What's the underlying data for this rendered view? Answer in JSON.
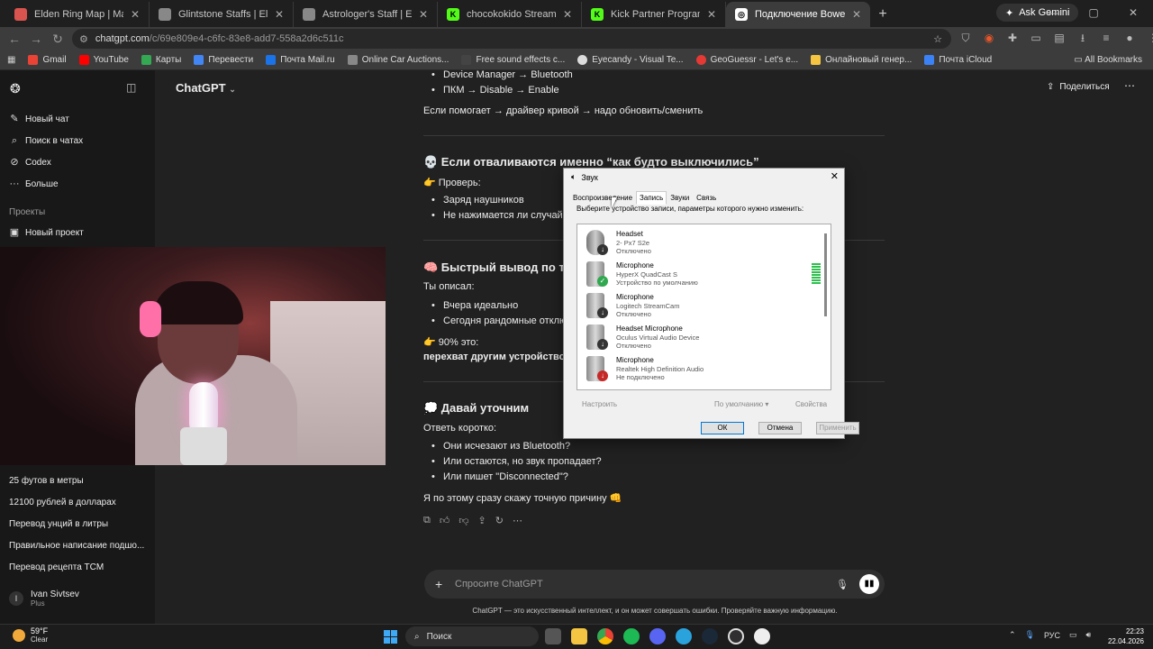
{
  "browser": {
    "tabs": [
      {
        "title": "Elden Ring Map | Map Genie",
        "color": "#d9534f"
      },
      {
        "title": "Glintstone Staffs | Elden Ring W",
        "color": "#888888"
      },
      {
        "title": "Astrologer's Staff | Elden Ring W",
        "color": "#888888"
      },
      {
        "title": "chocokokido Stream - Watch Li",
        "color": "#53fc18"
      },
      {
        "title": "Kick Partner Program - Kick De",
        "color": "#53fc18"
      },
      {
        "title": "Подключение Bowers & Wilkins",
        "color": "#ffffff"
      }
    ],
    "ask_gemini": "Ask Gemini",
    "url_host": "chatgpt.com",
    "url_path": "/c/69e809e4-c6fc-83e8-add7-558a2d6c511c",
    "bookmarks": [
      {
        "label": "Gmail",
        "color": "#ea4335"
      },
      {
        "label": "YouTube",
        "color": "#ff0000"
      },
      {
        "label": "Карты",
        "color": "#34a853"
      },
      {
        "label": "Перевести",
        "color": "#4285f4"
      },
      {
        "label": "Почта Mail.ru",
        "color": "#1a73e8"
      },
      {
        "label": "Online Car Auctions...",
        "color": "#888888"
      },
      {
        "label": "Free sound effects c...",
        "color": "#222222"
      },
      {
        "label": "Eyecandy - Visual Te...",
        "color": "#dddddd"
      },
      {
        "label": "GeoGuessr - Let's e...",
        "color": "#e53935"
      },
      {
        "label": "Онлайновый генер...",
        "color": "#f5c542"
      },
      {
        "label": "Почта iCloud",
        "color": "#3b82f6"
      }
    ],
    "all_bookmarks": "All Bookmarks"
  },
  "sidebar": {
    "new_chat": "Новый чат",
    "search_chats": "Поиск в чатах",
    "codex": "Codex",
    "more": "Больше",
    "projects_heading": "Проекты",
    "new_project": "Новый проект",
    "history": [
      "25 футов в метры",
      "12100 рублей в долларах",
      "Перевод унций в литры",
      "Правильное написание подшо...",
      "Перевод рецепта TCM"
    ],
    "user_name": "Ivan Sivtsev",
    "user_plan": "Plus",
    "user_initial": "I"
  },
  "header": {
    "title": "ChatGPT",
    "share": "Поделиться"
  },
  "chat": {
    "line1": "Device Manager → Bluetooth",
    "line2": "ПКМ → Disable → Enable",
    "line3": "Если помогает → драйвер кривой → надо обновить/сменить",
    "h1": "💀 Если отваливаются именно “как будто выключились”",
    "check": "👉 Проверь:",
    "b1": "Заряд наушников",
    "b2": "Не нажимается ли случайн",
    "h2": "🧠 Быстрый вывод по т",
    "you_said": "Ты описал:",
    "b3": "Вчера идеально",
    "b4": "Сегодня рандомные отклю",
    "pct": "👉 90% это:",
    "conclusion": "перехват другим устройством",
    "h3": "💭 Давай уточним",
    "answer": "Ответь коротко:",
    "q1": "Они исчезают из Bluetooth?",
    "q2": "Или остаются, но звук пропадает?",
    "q3": "Или пишет \"Disconnected\"?",
    "final": "Я по этому сразу скажу точную причину 👊"
  },
  "composer": {
    "placeholder": "Спросите ChatGPT",
    "disclaimer": "ChatGPT — это искусственный интеллект, и он может совершать ошибки. Проверяйте важную информацию."
  },
  "sound_dialog": {
    "title": "Звук",
    "tabs": [
      "Воспроизведение",
      "Запись",
      "Звуки",
      "Связь"
    ],
    "description": "Выберите устройство записи, параметры которого нужно изменить:",
    "devices": [
      {
        "name": "Headset",
        "sub": "2- Px7 S2e",
        "status": "Отключено",
        "badge": "down"
      },
      {
        "name": "Microphone",
        "sub": "HyperX QuadCast S",
        "status": "Устройство по умолчанию",
        "badge": "check"
      },
      {
        "name": "Microphone",
        "sub": "Logitech StreamCam",
        "status": "Отключено",
        "badge": "down"
      },
      {
        "name": "Headset Microphone",
        "sub": "Oculus Virtual Audio Device",
        "status": "Отключено",
        "badge": "down"
      },
      {
        "name": "Microphone",
        "sub": "Realtek High Definition Audio",
        "status": "Не подключено",
        "badge": "red"
      }
    ],
    "configure": "Настроить",
    "default": "По умолчанию",
    "properties": "Свойства",
    "ok": "ОК",
    "cancel": "Отмена",
    "apply": "Применить"
  },
  "taskbar": {
    "temp": "59°F",
    "weather": "Clear",
    "search": "Поиск",
    "lang": "РУС",
    "time": "22:23",
    "date": "22.04.2026"
  }
}
